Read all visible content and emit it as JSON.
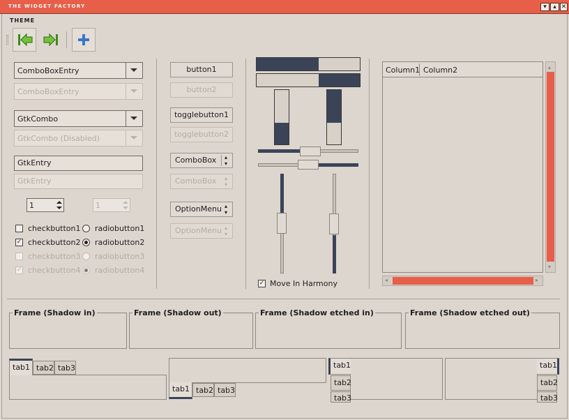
{
  "window": {
    "title": "THE WIDGET FACTORY",
    "btn_min": "▾",
    "btn_max": "▴",
    "btn_close": "✕"
  },
  "menu": {
    "theme": "THEME"
  },
  "combos": {
    "cbe": "ComboBoxEntry",
    "cbe_dis": "ComboBoxEntry",
    "gtkcombo": "GtkCombo",
    "gtkcombo_dis": "GtkCombo (Disabled)"
  },
  "entries": {
    "entry": "GtkEntry",
    "entry_dis": "GtkEntry"
  },
  "spin": {
    "value": "1",
    "value_dis": "1"
  },
  "checks": {
    "c1": "checkbutton1",
    "c2": "checkbutton2",
    "c3": "checkbutton3",
    "c4": "checkbutton4",
    "mark": "✓"
  },
  "radios": {
    "r1": "radiobutton1",
    "r2": "radiobutton2",
    "r3": "radiobutton3",
    "r4": "radiobutton4"
  },
  "buttons": {
    "b1": "button1",
    "b2": "button2",
    "t1": "togglebutton1",
    "t2": "togglebutton2",
    "cb": "ComboBox",
    "cb_dis": "ComboBox",
    "om": "OptionMenu",
    "om_dis": "OptionMenu"
  },
  "progress": {
    "h1": 0.6,
    "h2": 0.4,
    "v1": 0.4,
    "v2": 0.6
  },
  "move_harmony": "Move In Harmony",
  "tree": {
    "col1": "Column1",
    "col2": "Column2"
  },
  "frames": {
    "f1": "Frame (Shadow in)",
    "f2": "Frame (Shadow out)",
    "f3": "Frame (Shadow etched in)",
    "f4": "Frame (Shadow etched out)"
  },
  "tabs": {
    "t1": "tab1",
    "t2": "tab2",
    "t3": "tab3"
  },
  "colors": {
    "accent": "#e85f49",
    "dark": "#3b4457"
  }
}
